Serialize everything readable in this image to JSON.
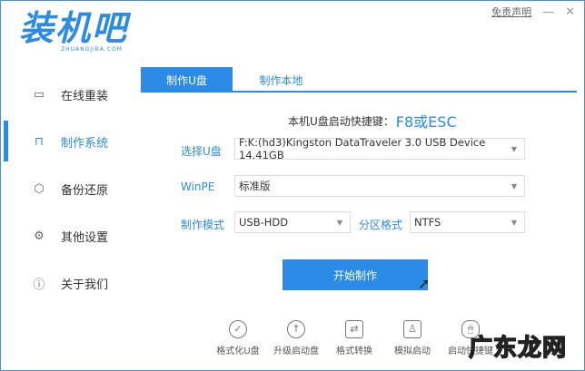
{
  "app": {
    "logo_text": "装机吧",
    "logo_sub": "ZHUANGJIBA.COM",
    "disclaimer": "免责声明",
    "minimize": "—",
    "close": "✕"
  },
  "sidebar": {
    "items": [
      {
        "label": "在线重装",
        "icon": "monitor-icon",
        "glyph": "▭"
      },
      {
        "label": "制作系统",
        "icon": "usb-icon",
        "glyph": "⊓"
      },
      {
        "label": "备份还原",
        "icon": "backup-icon",
        "glyph": "⬡"
      },
      {
        "label": "其他设置",
        "icon": "gear-icon",
        "glyph": "⚙"
      },
      {
        "label": "关于我们",
        "icon": "info-icon",
        "glyph": "ⓘ"
      }
    ]
  },
  "tabs": [
    {
      "label": "制作U盘"
    },
    {
      "label": "制作本地"
    }
  ],
  "hotkey": {
    "label": "本机U盘启动快捷键：",
    "value": "F8或ESC"
  },
  "form": {
    "usb_label": "选择U盘",
    "usb_value": "F:K:(hd3)Kingston DataTraveler 3.0 USB Device 14.41GB",
    "winpe_label": "WinPE",
    "winpe_value": "标准版",
    "mode_label": "制作模式",
    "mode_value": "USB-HDD",
    "fs_label": "分区格式",
    "fs_value": "NTFS"
  },
  "start_button": "开始制作",
  "tools": [
    {
      "label": "格式化U盘",
      "glyph": "✓"
    },
    {
      "label": "升级启动盘",
      "glyph": "↑"
    },
    {
      "label": "格式转换",
      "glyph": "⇄"
    },
    {
      "label": "模拟启动",
      "glyph": "♙"
    },
    {
      "label": "启动快捷键",
      "glyph": "🖱"
    }
  ],
  "watermark": "广东龙网",
  "colors": {
    "accent": "#2b8be6"
  }
}
